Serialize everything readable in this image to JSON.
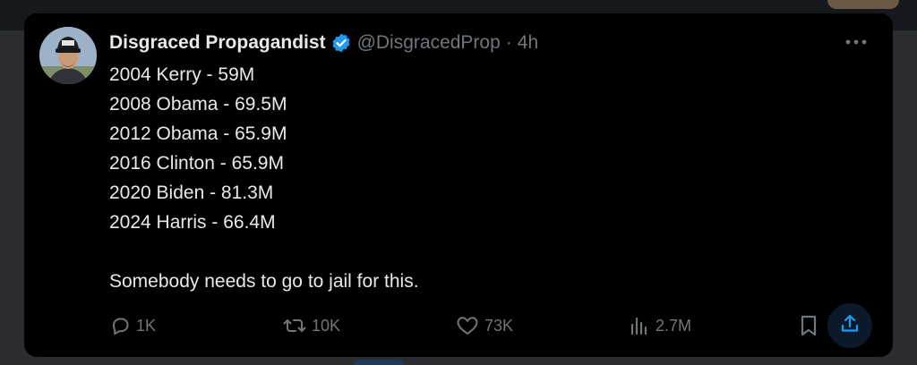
{
  "tweet": {
    "author_name": "Disgraced Propagandist",
    "handle": "@DisgracedProp",
    "separator": "·",
    "time": "4h",
    "lines": [
      "2004 Kerry - 59M",
      "2008 Obama - 69.5M",
      "2012 Obama - 65.9M",
      "2016 Clinton - 65.9M",
      "2020 Biden - 81.3M",
      "2024 Harris - 66.4M"
    ],
    "closing": "Somebody needs to go to jail for this.",
    "stats": {
      "replies": "1K",
      "reposts": "10K",
      "likes": "73K",
      "views": "2.7M"
    }
  },
  "icons": {
    "verified": "verified-badge-icon",
    "more": "more-options-icon",
    "reply": "reply-icon",
    "repost": "repost-icon",
    "like": "heart-icon",
    "views": "views-icon",
    "bookmark": "bookmark-icon",
    "share": "share-icon"
  },
  "colors": {
    "card_bg": "#000000",
    "text": "#e7e9ea",
    "muted": "#71767b",
    "verified": "#1d9bf0",
    "share_highlight": "#1d9bf0"
  }
}
